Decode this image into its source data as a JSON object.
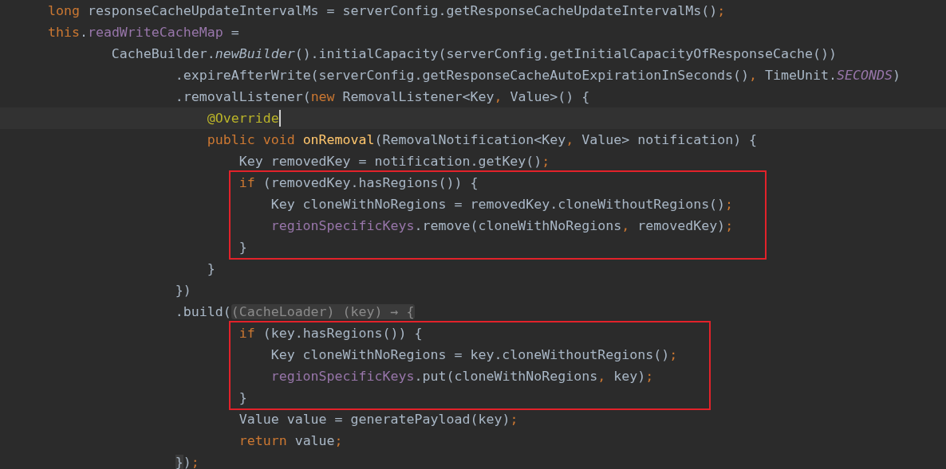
{
  "editor": {
    "items": [
      {
        "kind": "line",
        "tokens": [
          {
            "kind": "keyword",
            "text": "long "
          },
          {
            "kind": "plain",
            "text": "responseCacheUpdateIntervalMs = serverConfig.getResponseCacheUpdateIntervalMs()"
          },
          {
            "kind": "keyword",
            "text": ";"
          }
        ]
      },
      {
        "kind": "line",
        "tokens": [
          {
            "kind": "keyword",
            "text": "this"
          },
          {
            "kind": "plain",
            "text": "."
          },
          {
            "kind": "field",
            "text": "readWriteCacheMap"
          },
          {
            "kind": "plain",
            "text": " ="
          }
        ],
        "children": [
          {
            "kind": "wrapped",
            "tokens": [
              {
                "kind": "plain",
                "text": "CacheBuilder."
              },
              {
                "kind": "italic",
                "text": "newBuilder"
              },
              {
                "kind": "plain",
                "text": "().initialCapacity(serverConfig.getInitialCapacityOfResponseCache())"
              }
            ],
            "children": [
              {
                "kind": "wrapped",
                "tokens": [
                  {
                    "kind": "plain",
                    "text": ".expireAfterWrite(serverConfig.getResponseCacheAutoExpirationInSeconds()"
                  },
                  {
                    "kind": "keyword",
                    "text": ", "
                  },
                  {
                    "kind": "plain",
                    "text": "TimeUnit."
                  },
                  {
                    "kind": "constant",
                    "text": "SECONDS"
                  },
                  {
                    "kind": "plain",
                    "text": ")"
                  }
                ]
              },
              {
                "kind": "wrapped",
                "tokens": [
                  {
                    "kind": "plain",
                    "text": ".removalListener("
                  },
                  {
                    "kind": "keyword",
                    "text": "new "
                  },
                  {
                    "kind": "plain",
                    "text": "RemovalListener<Key"
                  },
                  {
                    "kind": "keyword",
                    "text": ", "
                  },
                  {
                    "kind": "plain",
                    "text": "Value>() {"
                  }
                ],
                "children": [
                  {
                    "kind": "line",
                    "current": true,
                    "tokens": [
                      {
                        "kind": "annotation",
                        "text": "@Override"
                      }
                    ]
                  },
                  {
                    "kind": "line",
                    "tokens": [
                      {
                        "kind": "keyword",
                        "text": "public void "
                      },
                      {
                        "kind": "method",
                        "text": "onRemoval"
                      },
                      {
                        "kind": "plain",
                        "text": "(RemovalNotification<Key"
                      },
                      {
                        "kind": "keyword",
                        "text": ", "
                      },
                      {
                        "kind": "plain",
                        "text": "Value> notification) {"
                      }
                    ],
                    "children": [
                      {
                        "kind": "line",
                        "tokens": [
                          {
                            "kind": "plain",
                            "text": "Key removedKey = notification.getKey()"
                          },
                          {
                            "kind": "keyword",
                            "text": ";"
                          }
                        ]
                      },
                      {
                        "kind": "line",
                        "boxed": true,
                        "tokens": [
                          {
                            "kind": "keyword",
                            "text": "if "
                          },
                          {
                            "kind": "plain",
                            "text": "(removedKey.hasRegions()) {"
                          }
                        ],
                        "children": [
                          {
                            "kind": "line",
                            "tokens": [
                              {
                                "kind": "plain",
                                "text": "Key cloneWithNoRegions = removedKey.cloneWithoutRegions()"
                              },
                              {
                                "kind": "keyword",
                                "text": ";"
                              }
                            ]
                          },
                          {
                            "kind": "line",
                            "tokens": [
                              {
                                "kind": "field",
                                "text": "regionSpecificKeys"
                              },
                              {
                                "kind": "plain",
                                "text": ".remove(cloneWithNoRegions"
                              },
                              {
                                "kind": "keyword",
                                "text": ", "
                              },
                              {
                                "kind": "plain",
                                "text": "removedKey)"
                              },
                              {
                                "kind": "keyword",
                                "text": ";"
                              }
                            ]
                          }
                        ]
                      },
                      {
                        "kind": "line",
                        "boxed": true,
                        "tokens": [
                          {
                            "kind": "plain",
                            "text": "}"
                          }
                        ]
                      }
                    ]
                  },
                  {
                    "kind": "line",
                    "tokens": [
                      {
                        "kind": "plain",
                        "text": "}"
                      }
                    ]
                  }
                ]
              },
              {
                "kind": "wrapped",
                "tokens": [
                  {
                    "kind": "plain",
                    "text": "})"
                  }
                ]
              },
              {
                "kind": "wrapped",
                "tokens": [
                  {
                    "kind": "plain",
                    "text": ".build("
                  },
                  {
                    "kind": "hint",
                    "text": "(CacheLoader) (key) → {"
                  }
                ],
                "children": [
                  {
                    "kind": "wrapped",
                    "boxed": true,
                    "tokens": [
                      {
                        "kind": "keyword",
                        "text": "if "
                      },
                      {
                        "kind": "plain",
                        "text": "(key.hasRegions()) {"
                      }
                    ],
                    "children": [
                      {
                        "kind": "line",
                        "tokens": [
                          {
                            "kind": "plain",
                            "text": "Key cloneWithNoRegions = key.cloneWithoutRegions()"
                          },
                          {
                            "kind": "keyword",
                            "text": ";"
                          }
                        ]
                      },
                      {
                        "kind": "line",
                        "tokens": [
                          {
                            "kind": "field",
                            "text": "regionSpecificKeys"
                          },
                          {
                            "kind": "plain",
                            "text": ".put(cloneWithNoRegions"
                          },
                          {
                            "kind": "keyword",
                            "text": ", "
                          },
                          {
                            "kind": "plain",
                            "text": "key)"
                          },
                          {
                            "kind": "keyword",
                            "text": ";"
                          }
                        ]
                      }
                    ]
                  },
                  {
                    "kind": "wrapped",
                    "boxed": true,
                    "tokens": [
                      {
                        "kind": "plain",
                        "text": "}"
                      }
                    ]
                  },
                  {
                    "kind": "wrapped",
                    "tokens": [
                      {
                        "kind": "plain",
                        "text": "Value value = generatePayload(key)"
                      },
                      {
                        "kind": "keyword",
                        "text": ";"
                      }
                    ]
                  },
                  {
                    "kind": "wrapped",
                    "tokens": [
                      {
                        "kind": "keyword",
                        "text": "return "
                      },
                      {
                        "kind": "plain",
                        "text": "value"
                      },
                      {
                        "kind": "keyword",
                        "text": ";"
                      }
                    ]
                  }
                ]
              },
              {
                "kind": "wrapped",
                "tokens": [
                  {
                    "kind": "matched",
                    "text": "}"
                  },
                  {
                    "kind": "plain",
                    "text": ")"
                  },
                  {
                    "kind": "keyword",
                    "text": ";"
                  }
                ]
              }
            ]
          }
        ]
      }
    ]
  }
}
